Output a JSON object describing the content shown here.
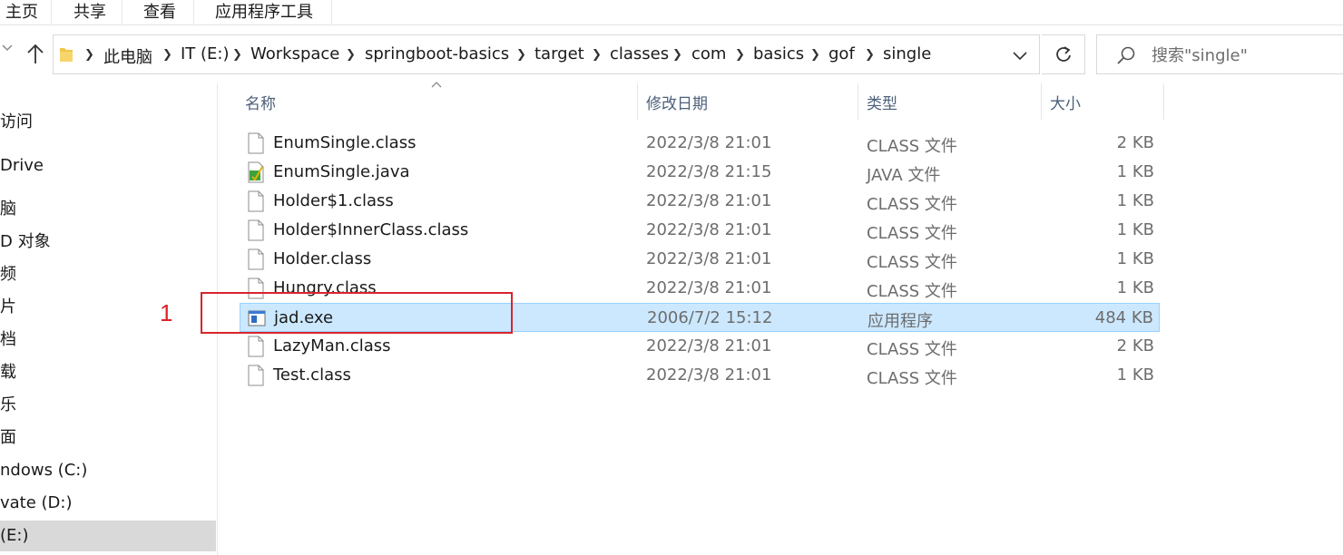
{
  "ribbon": {
    "tabs": [
      "主页",
      "共享",
      "查看",
      "应用程序工具"
    ]
  },
  "address": {
    "crumbs": [
      "此电脑",
      "IT (E:)",
      "Workspace",
      "springboot-basics",
      "target",
      "classes",
      "com",
      "basics",
      "gof",
      "single"
    ]
  },
  "search": {
    "placeholder": "搜索\"single\""
  },
  "nav": {
    "items": [
      "访问",
      "Drive",
      "脑",
      "D 对象",
      "频",
      "片",
      "档",
      "载",
      "乐",
      "面",
      "ndows (C:)",
      "vate (D:)",
      "(E:)"
    ]
  },
  "columns": {
    "name": "名称",
    "modified": "修改日期",
    "type": "类型",
    "size": "大小"
  },
  "files": [
    {
      "name": "EnumSingle.class",
      "date": "2022/3/8 21:01",
      "type": "CLASS 文件",
      "size": "2 KB",
      "icon": "file-icon"
    },
    {
      "name": "EnumSingle.java",
      "date": "2022/3/8 21:15",
      "type": "JAVA 文件",
      "size": "1 KB",
      "icon": "java-file-icon"
    },
    {
      "name": "Holder$1.class",
      "date": "2022/3/8 21:01",
      "type": "CLASS 文件",
      "size": "1 KB",
      "icon": "file-icon"
    },
    {
      "name": "Holder$InnerClass.class",
      "date": "2022/3/8 21:01",
      "type": "CLASS 文件",
      "size": "1 KB",
      "icon": "file-icon"
    },
    {
      "name": "Holder.class",
      "date": "2022/3/8 21:01",
      "type": "CLASS 文件",
      "size": "1 KB",
      "icon": "file-icon"
    },
    {
      "name": "Hungry.class",
      "date": "2022/3/8 21:01",
      "type": "CLASS 文件",
      "size": "1 KB",
      "icon": "file-icon"
    },
    {
      "name": "jad.exe",
      "date": "2006/7/2 15:12",
      "type": "应用程序",
      "size": "484 KB",
      "icon": "exe-icon"
    },
    {
      "name": "LazyMan.class",
      "date": "2022/3/8 21:01",
      "type": "CLASS 文件",
      "size": "2 KB",
      "icon": "file-icon"
    },
    {
      "name": "Test.class",
      "date": "2022/3/8 21:01",
      "type": "CLASS 文件",
      "size": "1 KB",
      "icon": "file-icon"
    }
  ],
  "selected_file": "jad.exe",
  "annotation": {
    "label": "1",
    "color": "#d9242b"
  },
  "colors": {
    "selection": "#cce8ff",
    "selection_border": "#99d1ff",
    "header_text": "#4c607a"
  }
}
